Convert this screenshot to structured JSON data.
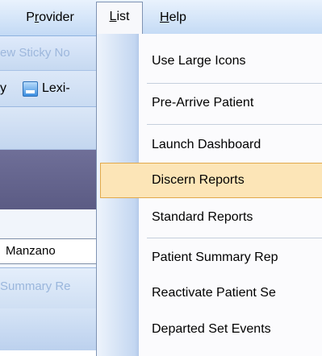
{
  "menubar": {
    "items": [
      {
        "label": "Provider"
      },
      {
        "label": "List"
      },
      {
        "label": "Help"
      }
    ]
  },
  "toolbar": {
    "sticky_note": "ew Sticky No",
    "y_fragment": "y",
    "lexi_label": "Lexi-"
  },
  "patient_tab": {
    "label": "Manzano"
  },
  "summary_bar": {
    "label": "Summary Re"
  },
  "list_menu": {
    "items": [
      {
        "label": "Use Large Icons"
      },
      {
        "label": "Pre-Arrive Patient"
      },
      {
        "label": "Launch Dashboard"
      },
      {
        "label": "Discern Reports",
        "highlighted": true
      },
      {
        "label": "Standard Reports"
      },
      {
        "label": "Patient Summary Rep"
      },
      {
        "label": "Reactivate Patient Se"
      },
      {
        "label": "Departed Set Events"
      }
    ]
  },
  "colors": {
    "highlight_fill": "#fce5b7",
    "highlight_border": "#e1a94b",
    "purple_band": "#6f6f98"
  }
}
